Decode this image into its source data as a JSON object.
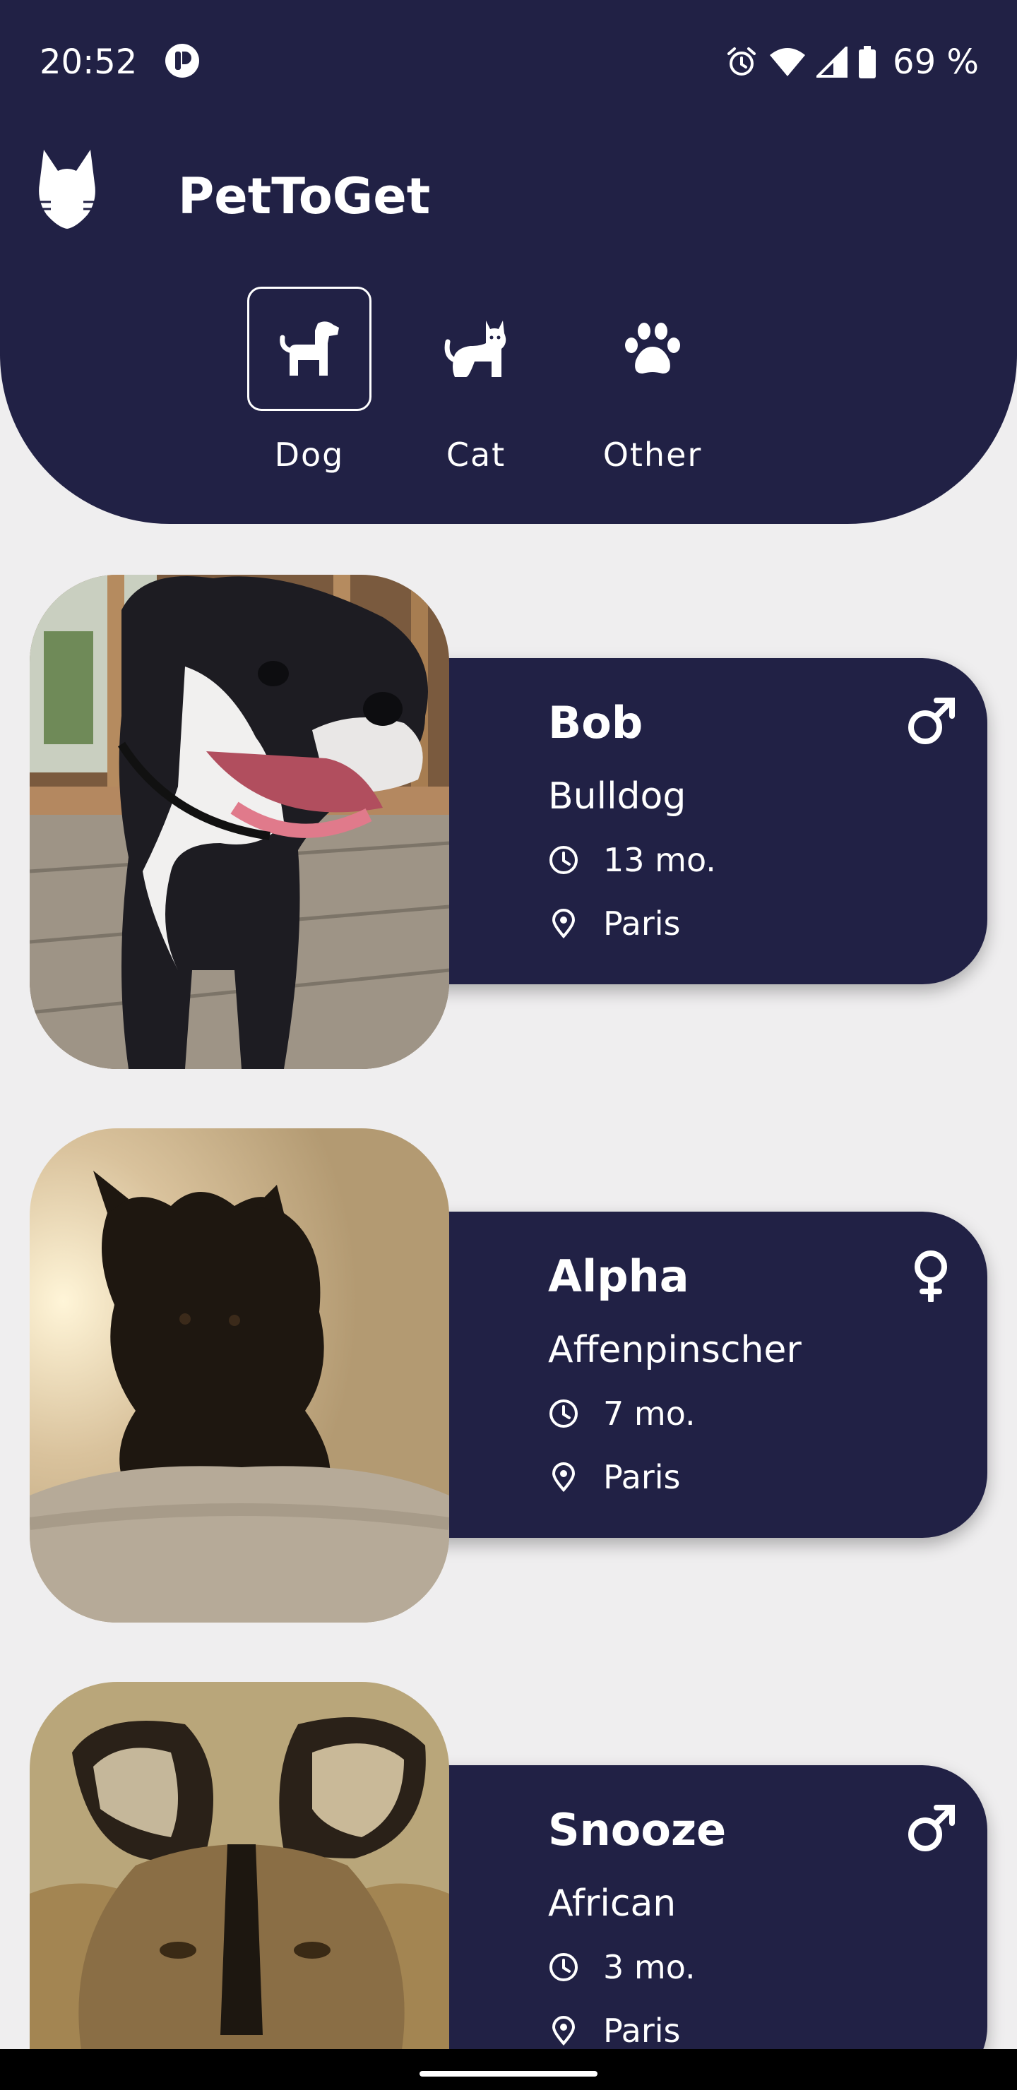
{
  "status_bar": {
    "time": "20:52",
    "battery_percent": "69 %"
  },
  "app": {
    "title": "PetToGet"
  },
  "tabs": [
    {
      "label": "Dog",
      "icon": "dog-icon",
      "selected": true
    },
    {
      "label": "Cat",
      "icon": "cat-icon",
      "selected": false
    },
    {
      "label": "Other",
      "icon": "paw-icon",
      "selected": false
    }
  ],
  "pets": [
    {
      "name": "Bob",
      "breed": "Bulldog",
      "age": "13 mo.",
      "location": "Paris",
      "sex": "male"
    },
    {
      "name": "Alpha",
      "breed": "Affenpinscher",
      "age": "7 mo.",
      "location": "Paris",
      "sex": "female"
    },
    {
      "name": "Snooze",
      "breed": "African",
      "age": "3 mo.",
      "location": "Paris",
      "sex": "male"
    }
  ],
  "colors": {
    "navy": "#212145",
    "background": "#efeeef",
    "text_light": "#ffffff"
  }
}
